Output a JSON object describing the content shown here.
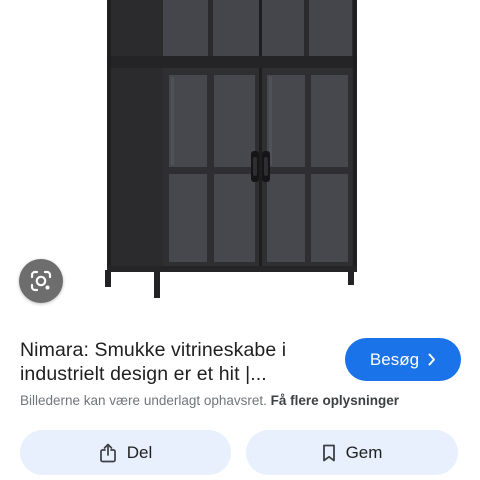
{
  "result": {
    "title": "Nimara: Smukke vitrineskabe i industrielt design er et hit |...",
    "visit_label": "Besøg",
    "copyright_text": "Billederne kan være underlagt ophavsret.",
    "more_info_link": "Få flere oplysninger"
  },
  "actions": {
    "share_label": "Del",
    "save_label": "Gem"
  },
  "icons": {
    "lens": "google-lens-icon",
    "visit_chevron": "chevron-right-icon",
    "share": "share-icon",
    "save": "bookmark-icon"
  },
  "colors": {
    "visit_button": "#1a73e8",
    "action_button_bg": "#e8f0fe",
    "title_text": "#1f1f1f",
    "secondary_text": "#70757a",
    "cabinet_frame": "#2b2b2e",
    "cabinet_glass": "#45474c"
  }
}
